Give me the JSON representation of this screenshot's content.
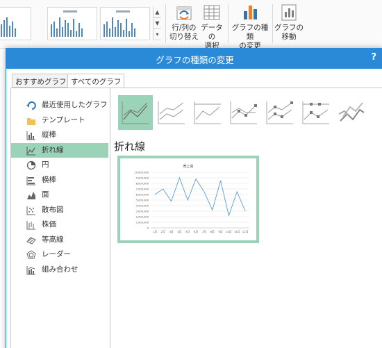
{
  "ribbon": {
    "buttons": [
      {
        "line1": "行/列の",
        "line2": "切り替え",
        "icon": "switch-row-column-icon"
      },
      {
        "line1": "データの",
        "line2": "選択",
        "icon": "select-data-icon"
      },
      {
        "line1": "グラフの種類",
        "line2": "の変更",
        "icon": "change-chart-type-icon"
      },
      {
        "line1": "グラフの",
        "line2": "移動",
        "icon": "move-chart-icon"
      }
    ]
  },
  "dialog": {
    "title": "グラフの種類の変更",
    "help": "?",
    "tabs": [
      "おすすめグラフ",
      "すべてのグラフ"
    ],
    "active_tab": 1,
    "categories": [
      {
        "label": "最近使用したグラフ",
        "icon": "undo-arrow-icon"
      },
      {
        "label": "テンプレート",
        "icon": "folder-icon"
      },
      {
        "label": "縦棒",
        "icon": "column-chart-icon"
      },
      {
        "label": "折れ線",
        "icon": "line-chart-icon"
      },
      {
        "label": "円",
        "icon": "pie-chart-icon"
      },
      {
        "label": "横棒",
        "icon": "bar-chart-icon"
      },
      {
        "label": "面",
        "icon": "area-chart-icon"
      },
      {
        "label": "散布図",
        "icon": "scatter-chart-icon"
      },
      {
        "label": "株価",
        "icon": "stock-chart-icon"
      },
      {
        "label": "等高線",
        "icon": "surface-chart-icon"
      },
      {
        "label": "レーダー",
        "icon": "radar-chart-icon"
      },
      {
        "label": "組み合わせ",
        "icon": "combo-chart-icon"
      }
    ],
    "selected_category": 3,
    "subtypes": [
      "line-icon",
      "stacked-line-icon",
      "percent-stacked-line-icon",
      "line-with-markers-icon",
      "stacked-line-with-markers-icon",
      "percent-stacked-line-with-markers-icon",
      "3d-line-icon"
    ],
    "selected_subtype": 0,
    "subtype_title": "折れ線"
  },
  "chart_data": {
    "type": "line",
    "title": "売上高",
    "categories": [
      "1月",
      "2月",
      "3月",
      "4月",
      "5月",
      "6月",
      "7月",
      "8月",
      "9月",
      "10月",
      "11月",
      "12月"
    ],
    "series": [
      {
        "values": [
          6000,
          7000,
          4800,
          9000,
          5000,
          8800,
          6500,
          3200,
          8500,
          2200,
          6500,
          3000
        ]
      }
    ],
    "ylim": [
      0,
      10000
    ],
    "ytick_labels": [
      "0",
      "1,000,000",
      "2,000,000",
      "3,000,000",
      "4,000,000",
      "5,000,000",
      "6,000,000",
      "7,000,000",
      "8,000,000",
      "9,000,000",
      "10,000,000"
    ],
    "grid": true,
    "line_color": "#5b9bd5"
  },
  "colors": {
    "accent": "#2b8ad8",
    "selection": "#9ad3b8"
  }
}
